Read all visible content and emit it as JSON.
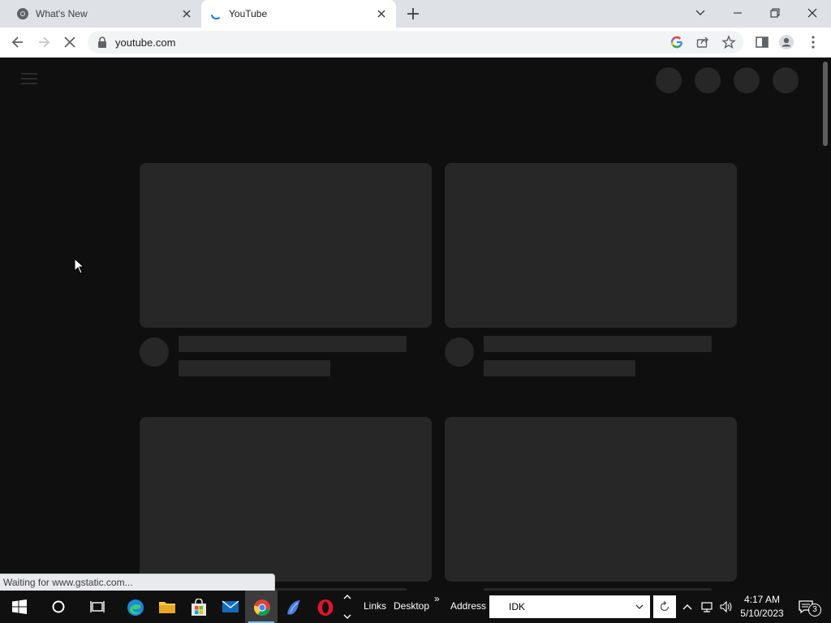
{
  "browser": {
    "tabs": [
      {
        "title": "What's New",
        "active": false,
        "icon": "chrome-icon"
      },
      {
        "title": "YouTube",
        "active": true,
        "icon": "loading-spinner-icon"
      }
    ],
    "address": "youtube.com",
    "status_text": "Waiting for www.gstatic.com..."
  },
  "taskbar": {
    "links_label": "Links",
    "desktop_label": "Desktop",
    "overflow_label": "»",
    "address_label": "Address",
    "address_value": "IDK",
    "time": "4:17 AM",
    "date": "5/10/2023",
    "notification_count": "3"
  },
  "colors": {
    "page_background": "#0f0f0f",
    "placeholder": "#272727",
    "tab_strip": "#dee1e6",
    "taskbar": "#101010"
  }
}
